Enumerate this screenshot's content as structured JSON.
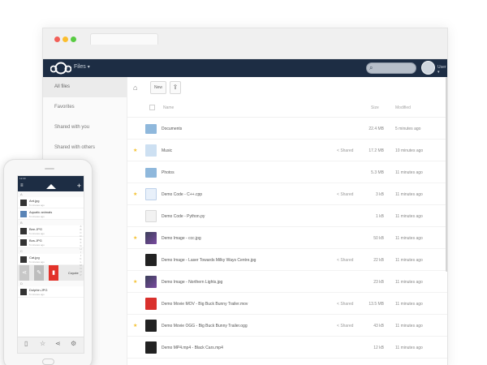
{
  "colors": {
    "topbar": "#1d2d44",
    "accent_red": "#e2322a",
    "star": "#f4c130"
  },
  "header": {
    "app_title": "Files",
    "user_name": "User"
  },
  "sidebar": {
    "items": [
      {
        "label": "All files",
        "active": true
      },
      {
        "label": "Favorites"
      },
      {
        "label": "Shared with you"
      },
      {
        "label": "Shared with others"
      }
    ]
  },
  "toolbar": {
    "new_label": "New",
    "upload_icon": "upload-icon",
    "home_icon": "home-icon"
  },
  "table": {
    "headers": {
      "name": "Name",
      "size": "Size",
      "modified": "Modified"
    },
    "rows": [
      {
        "name": "Documents",
        "size": "22.4 MB",
        "modified": "5 minutes ago",
        "star": false,
        "share": "",
        "thumb": "folder"
      },
      {
        "name": "Music",
        "size": "17.2 MB",
        "modified": "10 minutes ago",
        "star": true,
        "share": "Shared",
        "thumb": "music"
      },
      {
        "name": "Photos",
        "size": "5.3 MB",
        "modified": "11 minutes ago",
        "star": false,
        "share": "",
        "thumb": "folder"
      },
      {
        "name": "Demo Code - C++.cpp",
        "size": "3 kB",
        "modified": "11 minutes ago",
        "star": true,
        "share": "Shared",
        "thumb": "code"
      },
      {
        "name": "Demo Code - Python.py",
        "size": "1 kB",
        "modified": "11 minutes ago",
        "star": false,
        "share": "",
        "thumb": "doc"
      },
      {
        "name": "Demo Image - ccc.jpg",
        "size": "50 kB",
        "modified": "11 minutes ago",
        "star": true,
        "share": "",
        "thumb": "img"
      },
      {
        "name": "Demo Image - Laser Towards Milky Ways Centre.jpg",
        "size": "22 kB",
        "modified": "11 minutes ago",
        "star": false,
        "share": "Shared",
        "thumb": "dark"
      },
      {
        "name": "Demo Image - Northern Lights.jpg",
        "size": "23 kB",
        "modified": "11 minutes ago",
        "star": true,
        "share": "",
        "thumb": "img"
      },
      {
        "name": "Demo Movie MOV - Big Buck Bunny Trailer.mov",
        "size": "13.5 MB",
        "modified": "11 minutes ago",
        "star": false,
        "share": "Shared",
        "thumb": "red"
      },
      {
        "name": "Demo Movie OGG - Big Buck Bunny Trailer.ogg",
        "size": "43 kB",
        "modified": "11 minutes ago",
        "star": true,
        "share": "Shared",
        "thumb": "dark"
      },
      {
        "name": "Demo MP4.mp4 - Black Cars.mp4",
        "size": "12 kB",
        "modified": "11 minutes ago",
        "star": false,
        "share": "",
        "thumb": "dark"
      }
    ]
  },
  "phone": {
    "time": "12:00",
    "sections": [
      "A",
      "B",
      "C",
      "D"
    ],
    "rows": [
      {
        "name": "Ant.jpg",
        "sub": "5 minutes ago"
      },
      {
        "name": "Aquatic animals",
        "sub": "5 minutes ago"
      },
      {
        "name": "Bee.JPG",
        "sub": "5 minutes ago"
      },
      {
        "name": "Bos.JPG",
        "sub": "5 minutes ago"
      },
      {
        "name": "Cat.jpg",
        "sub": "5 minutes ago"
      },
      {
        "name": "Dolphin.JPG",
        "sub": "5 minutes ago"
      }
    ],
    "actions": [
      "Share",
      "Rename",
      "Delete",
      "Coyote"
    ]
  }
}
